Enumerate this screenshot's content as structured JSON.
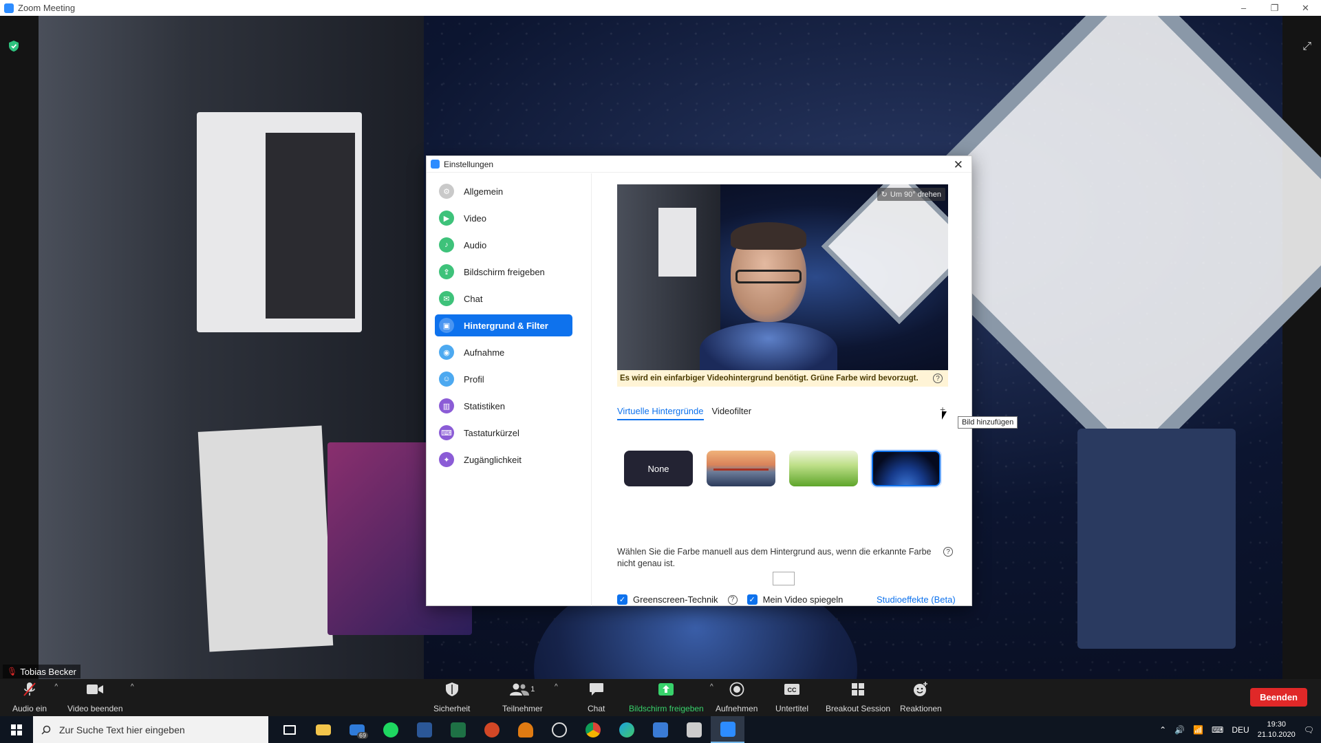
{
  "window": {
    "title": "Zoom Meeting",
    "controls": [
      "–",
      "❐",
      "✕"
    ]
  },
  "participant": {
    "name": "Tobias Becker"
  },
  "toolbar": {
    "audio": "Audio ein",
    "video": "Video beenden",
    "security": "Sicherheit",
    "participants": "Teilnehmer",
    "participants_count": "1",
    "chat": "Chat",
    "share": "Bildschirm freigeben",
    "record": "Aufnehmen",
    "captions": "Untertitel",
    "breakout": "Breakout Session",
    "reactions": "Reaktionen",
    "end": "Beenden"
  },
  "taskbar": {
    "search_placeholder": "Zur Suche Text hier eingeben",
    "mail_badge": "69",
    "language": "DEU",
    "time": "19:30",
    "date": "21.10.2020",
    "apps": [
      {
        "name": "task-view",
        "color": "#ffffff"
      },
      {
        "name": "file-explorer",
        "color": "#f3c54b"
      },
      {
        "name": "mail",
        "color": "#2f7bd9"
      },
      {
        "name": "spotify",
        "color": "#1ed760"
      },
      {
        "name": "word",
        "color": "#2b5797"
      },
      {
        "name": "excel",
        "color": "#1e7145"
      },
      {
        "name": "powerpoint",
        "color": "#d24726"
      },
      {
        "name": "vlc-cone",
        "color": "#e07b12"
      },
      {
        "name": "obs",
        "color": "#dddddd"
      },
      {
        "name": "chrome",
        "color": "#f2b705"
      },
      {
        "name": "edge",
        "color": "#1ba1e2"
      },
      {
        "name": "app-blue",
        "color": "#3a7bd5"
      },
      {
        "name": "app-notes",
        "color": "#cccccc"
      },
      {
        "name": "zoom",
        "color": "#2d8cff"
      }
    ]
  },
  "settings": {
    "title": "Einstellungen",
    "sidebar": [
      {
        "label": "Allgemein",
        "color": "#c9c9c9"
      },
      {
        "label": "Video",
        "color": "#3ec27a"
      },
      {
        "label": "Audio",
        "color": "#3ec27a"
      },
      {
        "label": "Bildschirm freigeben",
        "color": "#3ec27a"
      },
      {
        "label": "Chat",
        "color": "#3ec27a"
      },
      {
        "label": "Hintergrund & Filter",
        "color": "#0e72ed"
      },
      {
        "label": "Aufnahme",
        "color": "#4da9f0"
      },
      {
        "label": "Profil",
        "color": "#4da9f0"
      },
      {
        "label": "Statistiken",
        "color": "#8b5cd6"
      },
      {
        "label": "Tastaturkürzel",
        "color": "#8b5cd6"
      },
      {
        "label": "Zugänglichkeit",
        "color": "#8b5cd6"
      }
    ],
    "active_index": 5,
    "rotate_label": "Um 90° drehen",
    "notice": "Es wird ein einfarbiger Videohintergrund benötigt. Grüne Farbe wird bevorzugt.",
    "tabs": [
      "Virtuelle Hintergründe",
      "Videofilter"
    ],
    "add_tooltip": "Bild hinzufügen",
    "thumb_none": "None",
    "manual_text": "Wählen Sie die Farbe manuell aus dem Hintergrund aus, wenn die erkannte Farbe nicht genau ist.",
    "greenscreen": "Greenscreen-Technik",
    "mirror": "Mein Video spiegeln",
    "studio": "Studioeffekte (Beta)"
  },
  "colors": {
    "accent": "#0e72ed",
    "end_button": "#e02828",
    "share_green": "#38d26b"
  }
}
